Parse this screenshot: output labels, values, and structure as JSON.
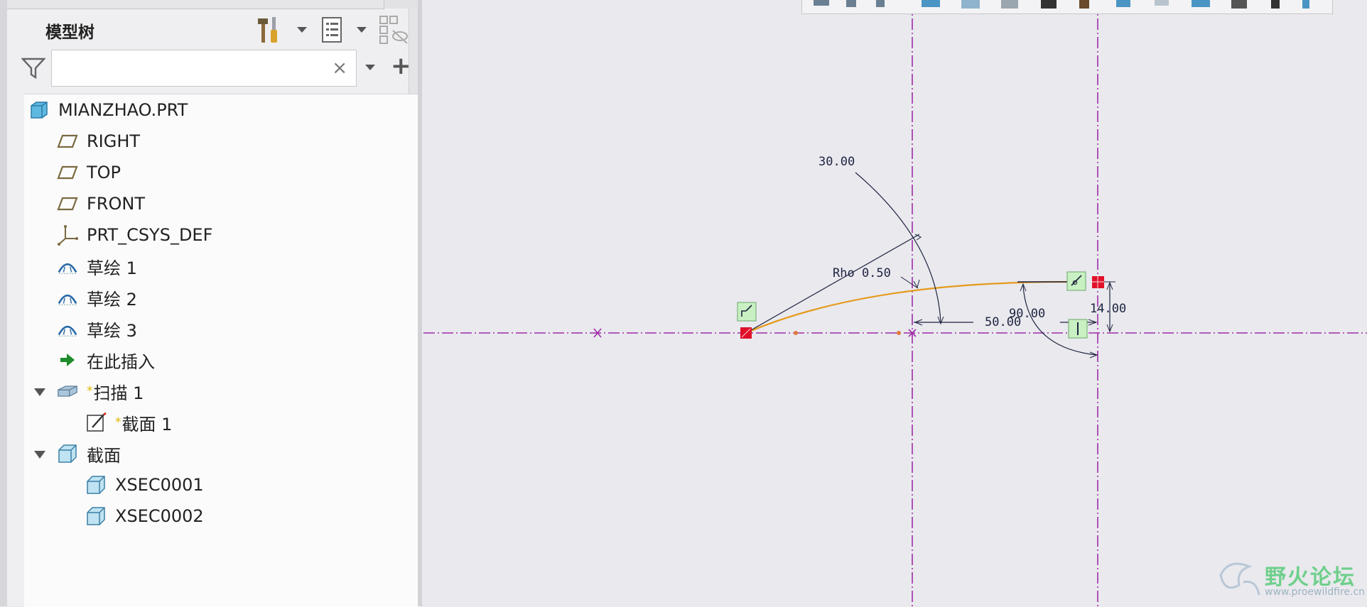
{
  "model_tree": {
    "title": "模型树",
    "search": {
      "value": "",
      "placeholder": ""
    },
    "clear_icon": "×",
    "add_icon": "+",
    "items": [
      {
        "label": "MIANZHAO.PRT",
        "icon": "part-icon"
      },
      {
        "label": "RIGHT",
        "icon": "datum-plane-icon"
      },
      {
        "label": "TOP",
        "icon": "datum-plane-icon"
      },
      {
        "label": "FRONT",
        "icon": "datum-plane-icon"
      },
      {
        "label": "PRT_CSYS_DEF",
        "icon": "csys-icon"
      },
      {
        "label": "草绘 1",
        "icon": "sketch-icon"
      },
      {
        "label": "草绘 2",
        "icon": "sketch-icon"
      },
      {
        "label": "草绘 3",
        "icon": "sketch-icon"
      },
      {
        "label": "在此插入",
        "icon": "insert-here-arrow-icon"
      },
      {
        "label": "扫描 1",
        "icon": "sweep-icon",
        "new_marker": "*"
      },
      {
        "label": "截面 1",
        "icon": "section-edit-icon",
        "new_marker": "*"
      },
      {
        "label": "截面",
        "icon": "section-folder-icon"
      },
      {
        "label": "XSEC0001",
        "icon": "xsec-icon"
      },
      {
        "label": "XSEC0002",
        "icon": "xsec-icon"
      }
    ]
  },
  "sketch": {
    "dim_angle": "30.00",
    "dim_rho": "Rho 0.50",
    "dim_angle_right": "90.00",
    "dim_horizontal": "50.00",
    "dim_vertical": "14.00",
    "curve_color": "#e69a1c",
    "centerline_color": "#a02ca8",
    "endpoint_color": "#e0102a"
  },
  "watermark": {
    "text": "野火论坛",
    "url": "www.proewildfire.cn"
  }
}
